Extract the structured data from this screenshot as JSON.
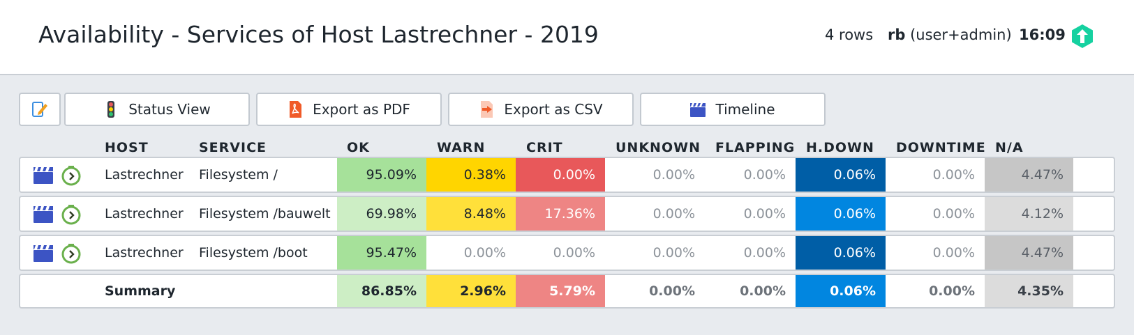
{
  "header": {
    "title": "Availability - Services of Host Lastrechner - 2019",
    "rows": "4 rows",
    "user_name": "rb",
    "user_role": " (user+admin)",
    "clock": "16:09",
    "logo_color": "#15d1a0"
  },
  "toolbar": {
    "edit_icon": "edit-icon",
    "status_view": "Status View",
    "export_pdf": "Export as PDF",
    "export_csv": "Export as CSV",
    "timeline": "Timeline"
  },
  "columns": [
    "HOST",
    "SERVICE",
    "OK",
    "WARN",
    "CRIT",
    "UNKNOWN",
    "FLAPPING",
    "H.DOWN",
    "DOWNTIME",
    "N/A"
  ],
  "rows": [
    {
      "host": "Lastrechner",
      "service": "Filesystem /",
      "ok": "95.09%",
      "warn": "0.38%",
      "crit": "0.00%",
      "unknown": "0.00%",
      "flapping": "0.00%",
      "hdown": "0.06%",
      "downtime": "0.00%",
      "na": "4.47%"
    },
    {
      "host": "Lastrechner",
      "service": "Filesystem /bauwelt",
      "ok": "69.98%",
      "warn": "8.48%",
      "crit": "17.36%",
      "unknown": "0.00%",
      "flapping": "0.00%",
      "hdown": "0.06%",
      "downtime": "0.00%",
      "na": "4.12%"
    },
    {
      "host": "Lastrechner",
      "service": "Filesystem /boot",
      "ok": "95.47%",
      "warn": "0.00%",
      "crit": "0.00%",
      "unknown": "0.00%",
      "flapping": "0.00%",
      "hdown": "0.06%",
      "downtime": "0.00%",
      "na": "4.47%"
    }
  ],
  "summary": {
    "label": "Summary",
    "ok": "86.85%",
    "warn": "2.96%",
    "crit": "5.79%",
    "unknown": "0.00%",
    "flapping": "0.00%",
    "hdown": "0.06%",
    "downtime": "0.00%",
    "na": "4.35%"
  },
  "colors": {
    "ok_strong": "#a6e19a",
    "ok_light": "#cdeec5",
    "warn_strong": "#ffd500",
    "warn_light": "#ffe03a",
    "crit_strong": "#e8585a",
    "crit_light": "#ee8584",
    "hdown_strong": "#005ea6",
    "hdown_light": "#0186e0",
    "na_strong": "#c6c6c6",
    "na_light": "#dcdcdc",
    "muted_text": "#8d939a"
  }
}
